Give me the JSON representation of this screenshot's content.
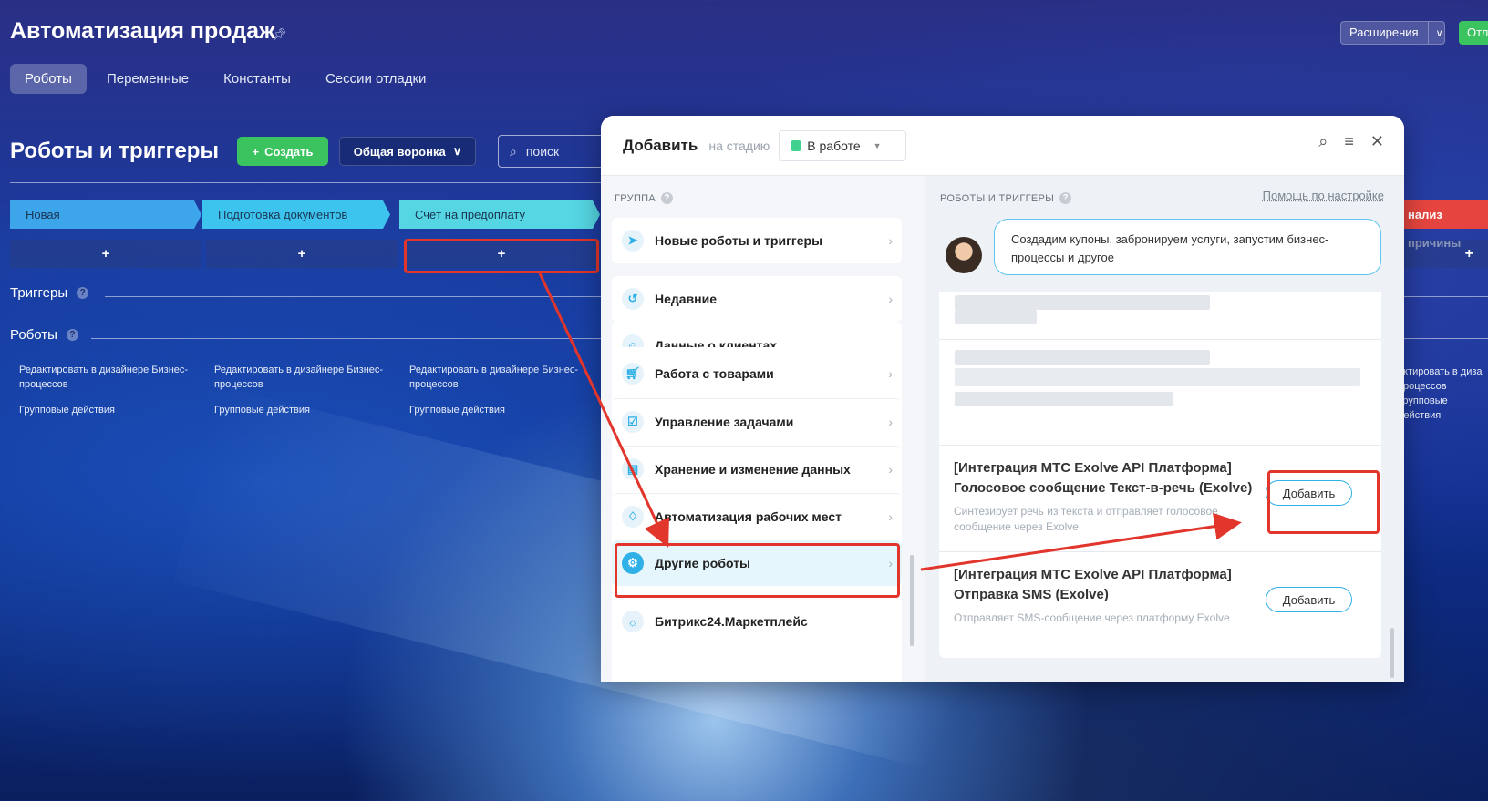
{
  "app": {
    "title": "Автоматизация продаж",
    "extensions_label": "Расширения",
    "debug_label": "Отла"
  },
  "tabs": [
    "Роботы",
    "Переменные",
    "Константы",
    "Сессии отладки"
  ],
  "toolbar": {
    "section_title": "Роботы и триггеры",
    "create_label": "Создать",
    "funnel_label": "Общая воронка",
    "search_placeholder": "поиск"
  },
  "stages": [
    {
      "name": "Новая",
      "color": "#3da5ea"
    },
    {
      "name": "Подготовка документов",
      "color": "#3cc3ee"
    },
    {
      "name": "Счёт на предоплату",
      "color": "#55d6e2"
    }
  ],
  "edge_stage": {
    "name": "нализ причины",
    "color": "#e6453f"
  },
  "rows": {
    "triggers": "Триггеры",
    "robots": "Роботы"
  },
  "stage_links": {
    "edit": "Редактировать в дизайнере Бизнес-процессов",
    "group": "Групповые действия",
    "edge_edit": "актировать в диза процессов",
    "edge_group": "Групповые действия"
  },
  "modal": {
    "title": "Добавить",
    "subtitle": "на стадию",
    "stage_value": "В работе",
    "group_label": "ГРУППА",
    "robots_label": "РОБОТЫ И ТРИГГЕРЫ",
    "help_link": "Помощь по настройке",
    "bubble_text": "Создадим купоны, забронируем услуги, запустим бизнес-процессы и другое",
    "groups": [
      {
        "label": "Новые роботы и триггеры",
        "icon": "rocket-icon"
      },
      {
        "label": "Недавние",
        "icon": "history-icon"
      },
      {
        "label": "Данные о клиентах",
        "icon": "users-icon"
      },
      {
        "label": "Работа с товарами",
        "icon": "cart-icon"
      },
      {
        "label": "Управление задачами",
        "icon": "task-icon"
      },
      {
        "label": "Хранение и изменение данных",
        "icon": "storage-icon"
      },
      {
        "label": "Автоматизация рабочих мест",
        "icon": "workplace-icon"
      },
      {
        "label": "Другие роботы",
        "icon": "robot-icon"
      },
      {
        "label": "Битрикс24.Маркетплейс",
        "icon": "marketplace-icon"
      }
    ],
    "robots": [
      {
        "title": "[Интеграция МТС Exolve API Платформа] Голосовое сообщение Текст-в-речь (Exolve)",
        "desc": "Синтезирует речь из текста и отправляет голосовое сообщение через Exolve",
        "button": "Добавить"
      },
      {
        "title": "[Интеграция МТС Exolve API Платформа] Отправка SMS (Exolve)",
        "desc": "Отправляет SMS-сообщение через платформу Exolve",
        "button": "Добавить"
      }
    ]
  },
  "colors": {
    "accent": "#2fb0e6",
    "green": "#3bc35f",
    "highlight": "#e2352b"
  }
}
